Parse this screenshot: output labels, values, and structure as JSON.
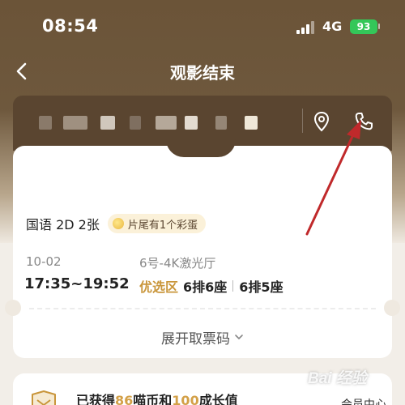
{
  "status_bar": {
    "time": "08:54",
    "network": "4G",
    "battery": "93"
  },
  "nav": {
    "title": "观影结束"
  },
  "ticket": {
    "language_format": "国语 2D 2张",
    "easter_egg": "片尾有1个彩蛋",
    "date": "10-02",
    "hall": "6号-4K激光厅",
    "showtime": "17:35~19:52",
    "zone": "优选区",
    "seats": [
      "6排6座",
      "6排5座"
    ],
    "expand_label": "展开取票码"
  },
  "reward": {
    "prefix": "已获得",
    "coins": "86",
    "middle": "喵币和",
    "growth": "100",
    "suffix": "成长值",
    "link": "会员中心 >"
  },
  "watermark": "Bai 经验",
  "colors": {
    "brand_brown": "#6b5438",
    "zone_gold": "#c9963b",
    "annotation_red": "#c0292b"
  }
}
